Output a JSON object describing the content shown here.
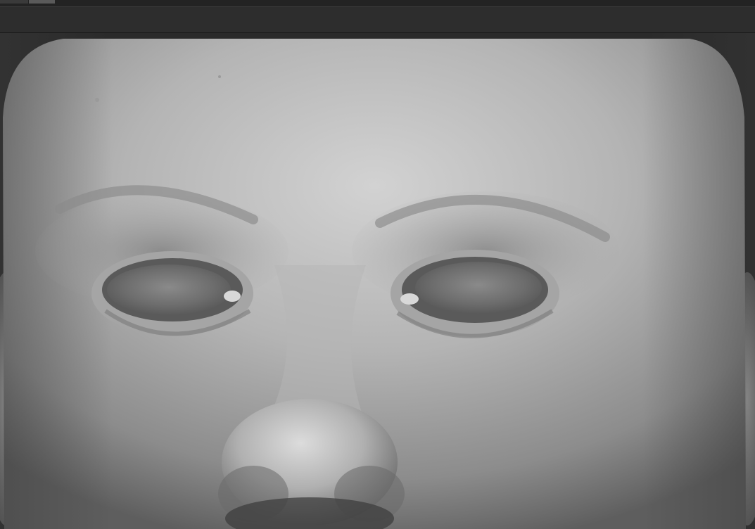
{
  "app": {
    "tabs": [
      {
        "label": ""
      },
      {
        "label": ""
      }
    ]
  },
  "viewport": {
    "content": "sculpt-head-closeup",
    "material_colors": {
      "background": "#2a2a2a",
      "skin_light": "#c9c9c9",
      "skin_mid": "#9a9a9a",
      "skin_dark": "#4a4a4a",
      "eye": "#6e6e6e"
    }
  }
}
